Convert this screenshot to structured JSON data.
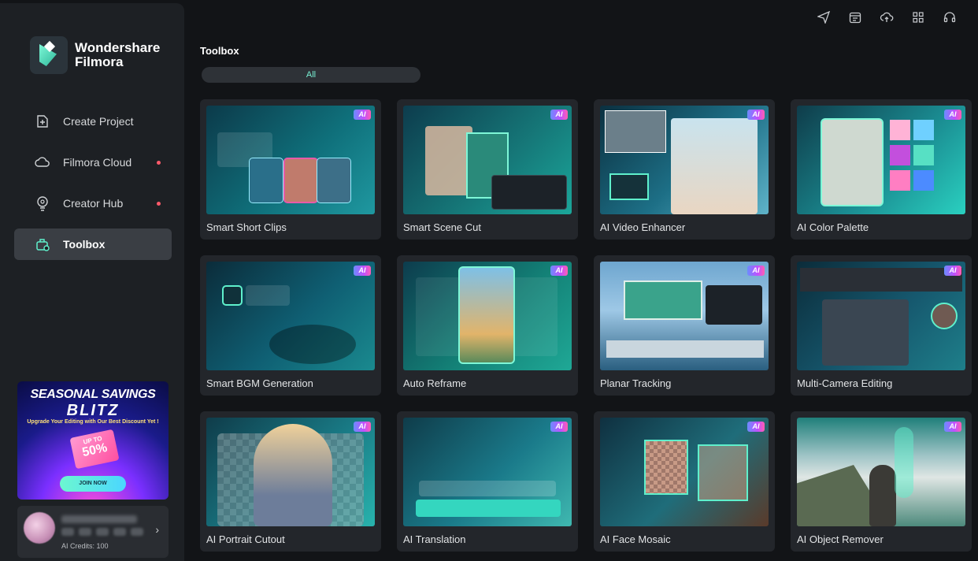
{
  "app": {
    "brand_line1": "Wondershare",
    "brand_line2": "Filmora"
  },
  "sidebar": {
    "items": [
      {
        "label": "Create Project",
        "icon": "add-file-icon",
        "dot": false,
        "active": false
      },
      {
        "label": "Filmora Cloud",
        "icon": "cloud-icon",
        "dot": true,
        "active": false
      },
      {
        "label": "Creator Hub",
        "icon": "bulb-icon",
        "dot": true,
        "active": false
      },
      {
        "label": "Toolbox",
        "icon": "toolbox-icon",
        "dot": false,
        "active": true
      }
    ]
  },
  "promo": {
    "line1": "SEASONAL SAVINGS",
    "line2": "BLITZ",
    "line3": "Upgrade Your Editing with Our Best Discount Yet !",
    "badge_top": "UP TO",
    "badge_value": "50%",
    "cta": "JOIN NOW"
  },
  "profile": {
    "credits": "AI Credits: 100"
  },
  "toolbar": {
    "icons": [
      "send-icon",
      "calendar-icon",
      "cloud-upload-icon",
      "grid-icon",
      "headset-icon"
    ]
  },
  "main": {
    "title": "Toolbox",
    "filter": "All",
    "ai_badge": "AI",
    "tools": [
      {
        "label": "Smart Short Clips",
        "theme": "#0f6f7a"
      },
      {
        "label": "Smart Scene Cut",
        "theme": "#167a7a"
      },
      {
        "label": "AI Video Enhancer",
        "theme": "#1d6f86"
      },
      {
        "label": "AI Color Palette",
        "theme": "#1a8a90"
      },
      {
        "label": "Smart BGM Generation",
        "theme": "#0f5f73"
      },
      {
        "label": "Auto Reframe",
        "theme": "#138076"
      },
      {
        "label": "Planar Tracking",
        "theme": "#2a5f80"
      },
      {
        "label": "Multi-Camera Editing",
        "theme": "#16586e"
      },
      {
        "label": "AI Portrait Cutout",
        "theme": "#197a85"
      },
      {
        "label": "AI Translation",
        "theme": "#1a7a8a"
      },
      {
        "label": "AI Face Mosaic",
        "theme": "#1f6d7a"
      },
      {
        "label": "AI Object Remover",
        "theme": "#4d8a7c"
      }
    ]
  }
}
